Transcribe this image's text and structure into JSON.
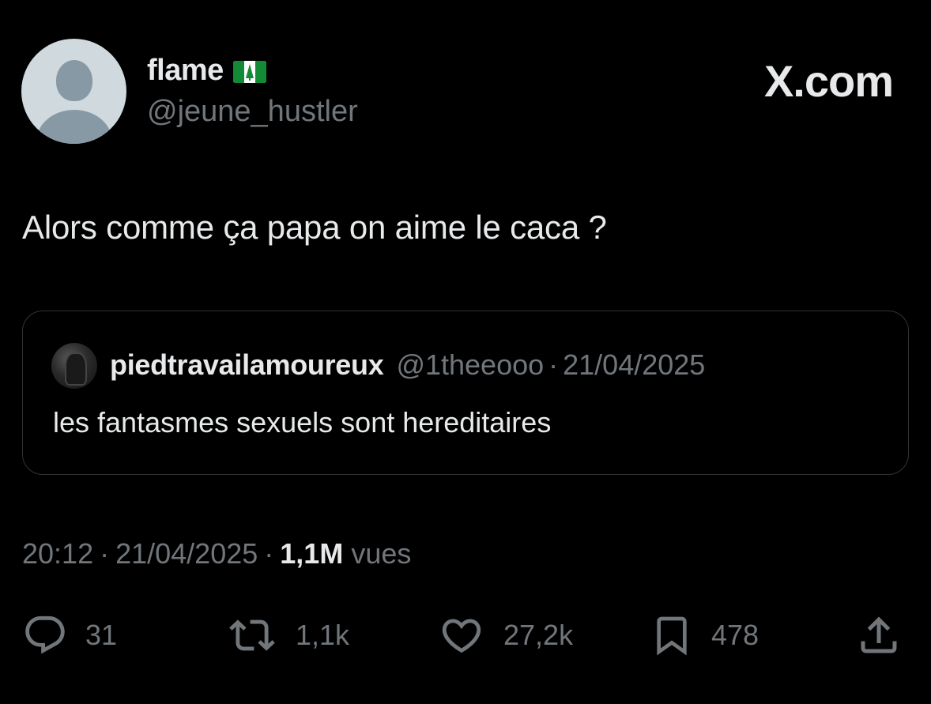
{
  "header": {
    "display_name": "flame",
    "handle": "@jeune_hustler",
    "site_logo": "X.com",
    "flag_icon": "norfolk-island-flag-icon"
  },
  "tweet": {
    "text": "Alors comme ça papa on aime le caca ?"
  },
  "quote": {
    "name": "piedtravailamoureux",
    "handle": "@1theeooo",
    "separator": "·",
    "date": "21/04/2025",
    "text": "les fantasmes sexuels sont hereditaires"
  },
  "meta": {
    "time": "20:12",
    "separator": "·",
    "date": "21/04/2025",
    "views_count": "1,1M",
    "views_label": "vues"
  },
  "actions": {
    "reply_count": "31",
    "retweet_count": "1,1k",
    "like_count": "27,2k",
    "bookmark_count": "478"
  },
  "colors": {
    "background": "#000000",
    "primary_text": "#e7e9ea",
    "secondary_text": "#71767b",
    "border": "#2f3336",
    "flag_green": "#138a36"
  }
}
